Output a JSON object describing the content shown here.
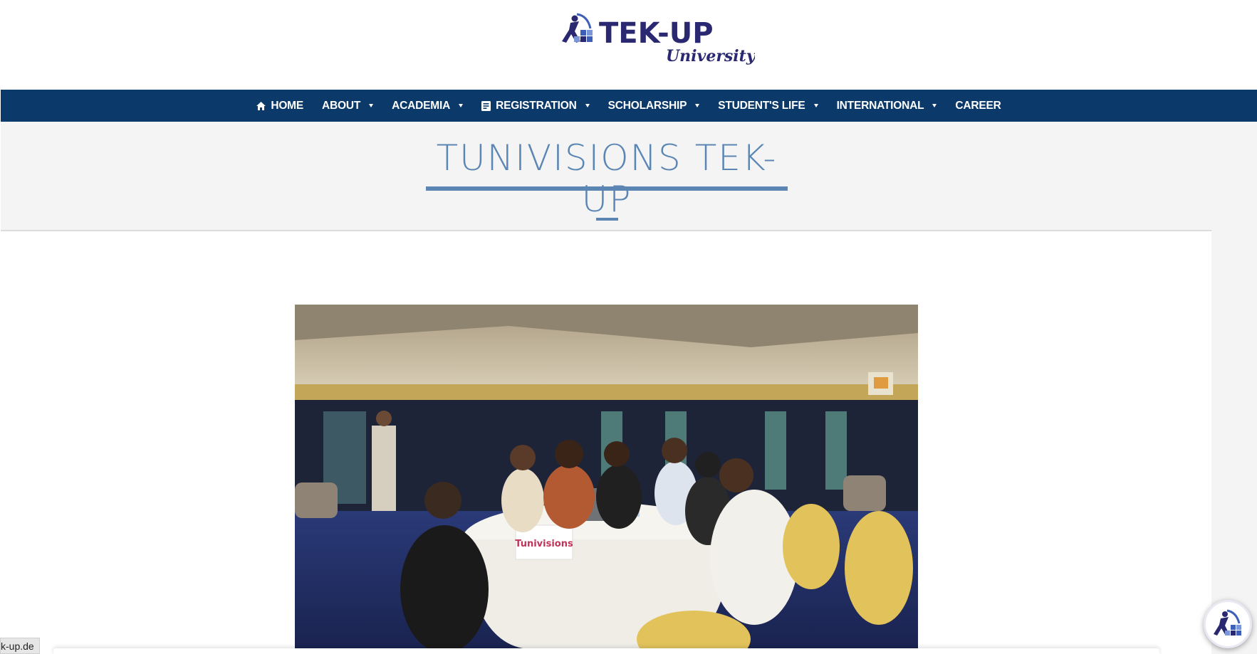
{
  "header": {
    "logo_text": "TEK-UP",
    "logo_subtext": "University"
  },
  "nav": {
    "items": [
      {
        "label": "HOME",
        "icon": "home-icon",
        "dropdown": false
      },
      {
        "label": "ABOUT",
        "icon": null,
        "dropdown": true
      },
      {
        "label": "ACADEMIA",
        "icon": null,
        "dropdown": true
      },
      {
        "label": "REGISTRATION",
        "icon": "document-icon",
        "dropdown": true
      },
      {
        "label": "SCHOLARSHIP",
        "icon": null,
        "dropdown": true
      },
      {
        "label": "STUDENT'S LIFE",
        "icon": null,
        "dropdown": true
      },
      {
        "label": "INTERNATIONAL",
        "icon": null,
        "dropdown": true
      },
      {
        "label": "CAREER",
        "icon": null,
        "dropdown": false
      }
    ]
  },
  "page": {
    "title": "TUNIVISIONS TEK-UP"
  },
  "photo": {
    "table_sign": "Tunivisions"
  },
  "status_bar": {
    "url": "k-up.de"
  },
  "colors": {
    "nav_bg": "#0b3a6a",
    "accent": "#5b86b3",
    "logo_navy": "#2a2870",
    "band_bg": "#f4f4f4"
  }
}
